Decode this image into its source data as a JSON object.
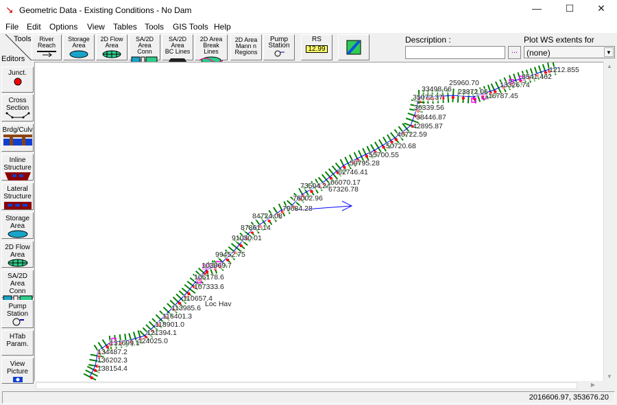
{
  "window": {
    "title": "Geometric Data - Existing Conditions - No Dam",
    "minimize": "—",
    "maximize": "☐",
    "close": "✕"
  },
  "menu": [
    "File",
    "Edit",
    "Options",
    "View",
    "Tables",
    "Tools",
    "GIS Tools",
    "Help"
  ],
  "toolbar": {
    "tools_label": "Tools",
    "editors_label": "Editors",
    "buttons": [
      {
        "l1": "River",
        "l2": "Reach"
      },
      {
        "l1": "Storage",
        "l2": "Area"
      },
      {
        "l1": "2D Flow",
        "l2": "Area"
      },
      {
        "l1": "SA/2D Area",
        "l2": "Conn"
      },
      {
        "l1": "SA/2D Area",
        "l2": "BC Lines"
      },
      {
        "l1": "2D Area",
        "l2": "Break Lines"
      },
      {
        "l1": "2D Area",
        "l2": "Mann n",
        "l3": "Regions"
      },
      {
        "l1": "Pump",
        "l2": "Station"
      },
      {
        "l1": "RS",
        "l2": "12.99"
      }
    ],
    "description_label": "Description :",
    "description_value": "",
    "ellipsis": "...",
    "profile_label": "Plot WS extents for Profile:",
    "profile_value": "(none)"
  },
  "editors": [
    {
      "l1": "Junct.",
      "l2": ""
    },
    {
      "l1": "Cross",
      "l2": "Section"
    },
    {
      "l1": "Brdg/Culv",
      "l2": ""
    },
    {
      "l1": "Inline",
      "l2": "Structure"
    },
    {
      "l1": "Lateral",
      "l2": "Structure"
    },
    {
      "l1": "Storage",
      "l2": "Area"
    },
    {
      "l1": "2D Flow",
      "l2": "Area"
    },
    {
      "l1": "SA/2D Area",
      "l2": "Conn"
    },
    {
      "l1": "Pump",
      "l2": "Station"
    },
    {
      "l1": "HTab",
      "l2": "Param."
    },
    {
      "l1": "View",
      "l2": "Picture"
    }
  ],
  "map": {
    "reach_label": "Loc Hav",
    "stations": [
      "1212.855",
      "8541.462",
      "13326.74",
      "16787.45",
      "25960.70",
      "33498.66",
      "23872.06",
      "35072.37",
      "36339.56",
      "38446.87",
      "42895.87",
      "46722.59",
      "50720.68",
      "55700.55",
      "59795.28",
      "62746.41",
      "66070.17",
      "73504.24",
      "67326.78",
      "76002.96",
      "79684.28",
      "84724.08",
      "87861.14",
      "91030.01",
      "99452.75",
      "103869.7",
      "105178.6",
      "107333.6",
      "110657.4",
      "113985.6",
      "116401.3",
      "118901.0",
      "121394.1",
      "124025.0",
      "131699.1",
      "134487.2",
      "136202.3",
      "138154.4"
    ],
    "colors": {
      "river": "#0000ff",
      "xs": "#008000",
      "bank": "#ff0000",
      "structure": "#ff00ff"
    }
  },
  "status": {
    "coords": "2016606.97, 353676.20"
  }
}
